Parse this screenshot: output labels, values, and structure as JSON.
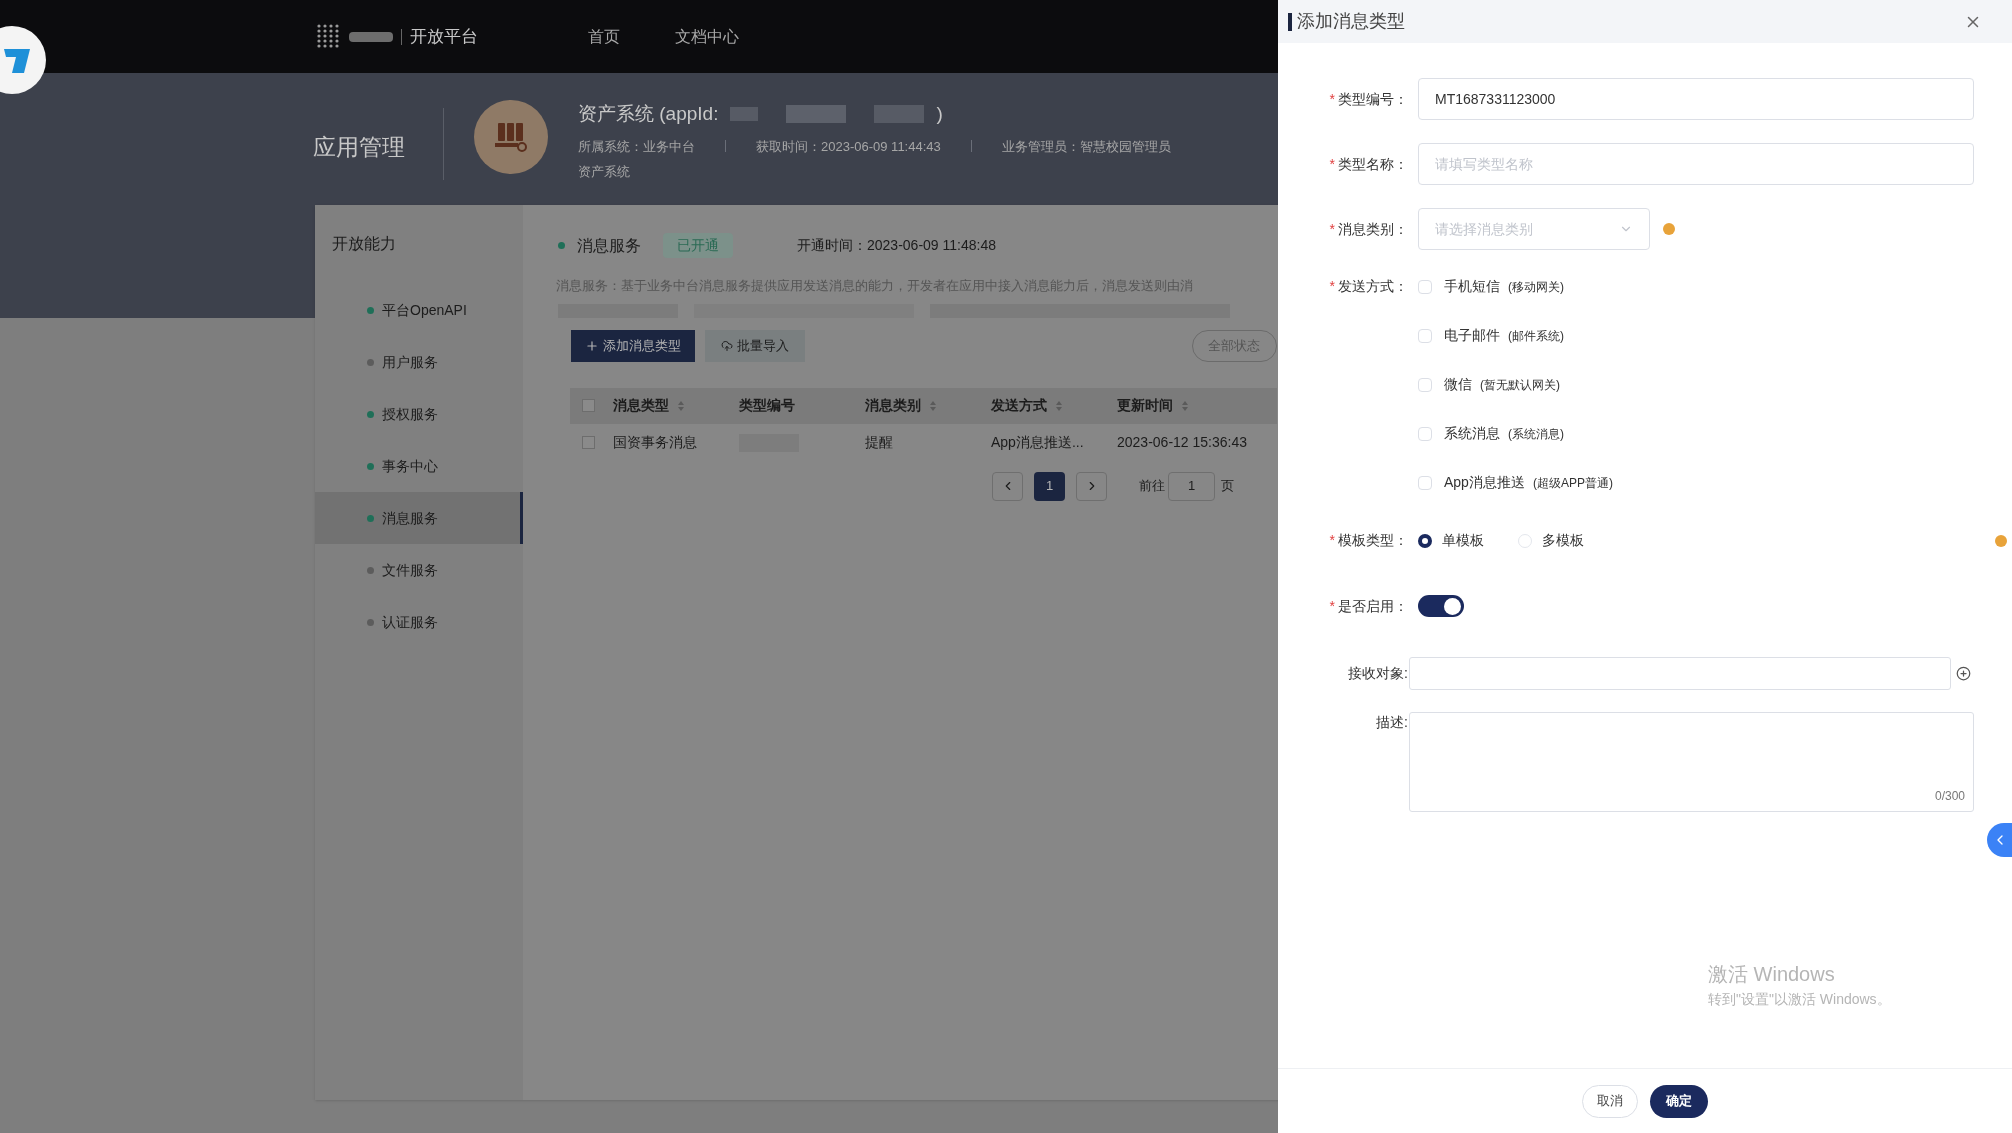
{
  "nav": {
    "brand": "开放平台",
    "links": [
      "首页",
      "文档中心"
    ]
  },
  "header": {
    "title": "应用管理",
    "app_title": "资产系统 (appId:",
    "app_title_end": ")",
    "meta": [
      "所属系统：业务中台",
      "获取时间：2023-06-09 11:44:43",
      "业务管理员：智慧校园管理员"
    ],
    "app_subtitle": "资产系统"
  },
  "sidebar": {
    "title": "开放能力",
    "items": [
      {
        "label": "平台OpenAPI",
        "color": "#1f6f58",
        "selected": false
      },
      {
        "label": "用户服务",
        "color": "#5c5c5c",
        "selected": false
      },
      {
        "label": "授权服务",
        "color": "#1f6f58",
        "selected": false
      },
      {
        "label": "事务中心",
        "color": "#1f6f58",
        "selected": false
      },
      {
        "label": "消息服务",
        "color": "#1f6f58",
        "selected": true
      },
      {
        "label": "文件服务",
        "color": "#5c5c5c",
        "selected": false
      },
      {
        "label": "认证服务",
        "color": "#5c5c5c",
        "selected": false
      }
    ]
  },
  "service": {
    "name": "消息服务",
    "status": "已开通",
    "opened_time": "开通时间：2023-06-09 11:48:48",
    "description": "消息服务：基于业务中台消息服务提供应用发送消息的能力，开发者在应用中接入消息能力后，消息发送则由消"
  },
  "toolbar": {
    "add_button": "添加消息类型",
    "import_button": "批量导入",
    "status_filter": "全部状态"
  },
  "table": {
    "all_checked": false,
    "columns": [
      {
        "label": "消息类型",
        "sortable": true
      },
      {
        "label": "类型编号",
        "sortable": false
      },
      {
        "label": "消息类别",
        "sortable": true
      },
      {
        "label": "发送方式",
        "sortable": true
      },
      {
        "label": "更新时间",
        "sortable": true
      }
    ],
    "rows": [
      {
        "checked": false,
        "cells": [
          "国资事务消息",
          "",
          "提醒",
          "App消息推送...",
          "2023-06-12 15:36:43"
        ]
      }
    ]
  },
  "pagination": {
    "pages": [
      {
        "label": "1",
        "selected": true
      }
    ],
    "goto_label": "前往",
    "goto_value": "1",
    "page_suffix": "页"
  },
  "drawer": {
    "title": "添加消息类型",
    "fields": [
      {
        "kind": "text",
        "label": "类型编号：",
        "required_mark": "*",
        "value": "MT1687331123000"
      },
      {
        "kind": "text",
        "label": "类型名称：",
        "required_mark": "*",
        "placeholder": "请填写类型名称"
      },
      {
        "kind": "select",
        "label": "消息类别：",
        "required_mark": "*",
        "placeholder": "请选择消息类别",
        "hint_dot": true
      },
      {
        "kind": "checkboxes",
        "label": "发送方式：",
        "required_mark": "*",
        "options": [
          {
            "label": "手机短信",
            "note": "(移动网关)",
            "checked": false
          },
          {
            "label": "电子邮件",
            "note": "(邮件系统)",
            "checked": false
          },
          {
            "label": "微信",
            "note": "(暂无默认网关)",
            "checked": false
          },
          {
            "label": "系统消息",
            "note": "(系统消息)",
            "checked": false
          },
          {
            "label": "App消息推送",
            "note": "(超级APP普通)",
            "checked": false
          }
        ]
      },
      {
        "kind": "radio",
        "label": "模板类型：",
        "required_mark": "*",
        "hint_dot": true,
        "options": [
          {
            "label": "单模板",
            "selected": true
          },
          {
            "label": "多模板",
            "selected": false
          }
        ]
      },
      {
        "kind": "switch",
        "label": "是否启用：",
        "required_mark": "*",
        "on": true
      },
      {
        "kind": "picker",
        "label": "接收对象:"
      },
      {
        "kind": "textarea",
        "label": "描述:",
        "counter": "0/300"
      }
    ],
    "cancel": "取消",
    "confirm": "确定"
  },
  "windows_notice": {
    "title": "激活 Windows",
    "subtitle": "转到\"设置\"以激活 Windows。"
  }
}
